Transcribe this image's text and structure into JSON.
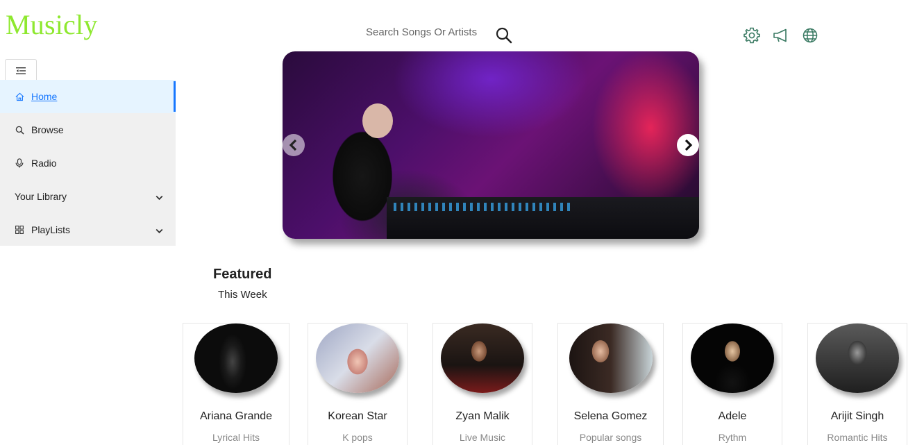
{
  "app": {
    "logo": "Musicly"
  },
  "search": {
    "placeholder": "Search Songs Or Artists"
  },
  "sidebar": {
    "items": [
      {
        "label": "Home",
        "icon": "home-icon",
        "active": true
      },
      {
        "label": "Browse",
        "icon": "search-icon"
      },
      {
        "label": "Radio",
        "icon": "microphone-icon"
      },
      {
        "label": "Your Library",
        "icon": "",
        "expandable": true
      },
      {
        "label": "PlayLists",
        "icon": "grid-icon",
        "expandable": true
      }
    ]
  },
  "header_icons": [
    "settings-icon",
    "megaphone-icon",
    "globe-icon"
  ],
  "featured": {
    "title": "Featured",
    "subtitle": "This Week"
  },
  "artists": [
    {
      "name": "Ariana Grande",
      "desc": "Lyrical Hits"
    },
    {
      "name": "Korean Star",
      "desc": "K pops"
    },
    {
      "name": "Zyan Malik",
      "desc": "Live Music"
    },
    {
      "name": "Selena Gomez",
      "desc": "Popular songs"
    },
    {
      "name": "Adele",
      "desc": "Rythm"
    },
    {
      "name": "Arijit Singh",
      "desc": "Romantic Hits"
    }
  ],
  "colors": {
    "brand": "#8ee82f",
    "accent": "#1677ff",
    "icon_green": "#3a7a63"
  }
}
